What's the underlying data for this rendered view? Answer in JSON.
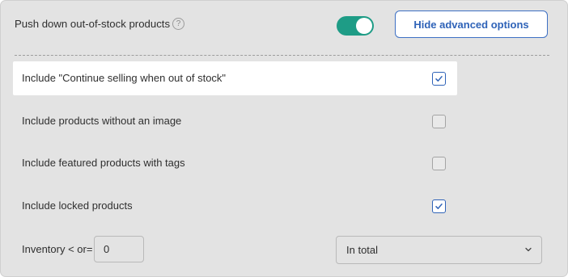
{
  "header": {
    "label": "Push down out-of-stock products",
    "help_icon": "help-circle-icon",
    "help_glyph": "?",
    "toggle_on": true,
    "hide_button_label": "Hide advanced options"
  },
  "options": [
    {
      "label": "Include \"Continue selling when out of stock\"",
      "checked": true,
      "highlighted": true
    },
    {
      "label": "Include products without an image",
      "checked": false,
      "highlighted": false
    },
    {
      "label": "Include featured products with tags",
      "checked": false,
      "highlighted": false
    },
    {
      "label": "Include locked products",
      "checked": true,
      "highlighted": false
    }
  ],
  "inventory": {
    "label": "Inventory < or=",
    "value": "0"
  },
  "scope_select": {
    "value": "In total",
    "icon": "chevron-down-icon"
  },
  "colors": {
    "accent": "#2f63b8",
    "toggle_on": "#1e9c86",
    "panel_bg": "#e3e3e3",
    "highlight_bg": "#ffffff"
  }
}
